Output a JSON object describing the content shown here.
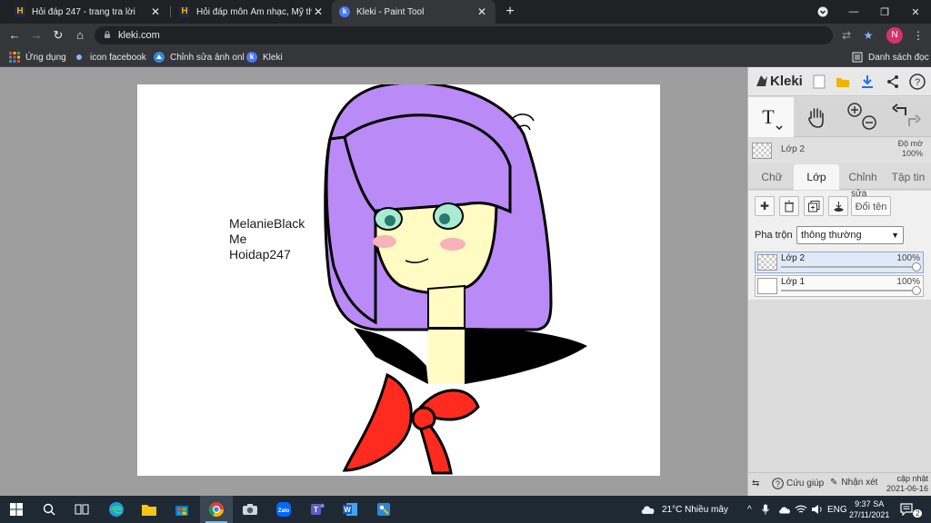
{
  "browser": {
    "tabs": [
      {
        "title": "Hỏi đáp 247 - trang tra lời",
        "favicon": "hoidap-favicon",
        "active": false
      },
      {
        "title": "Hỏi đáp môn Âm nhạc, Mỹ thuật",
        "favicon": "hoidap-favicon",
        "active": false
      },
      {
        "title": "Kleki - Paint Tool",
        "favicon": "kleki-favicon",
        "active": true
      }
    ],
    "url": "kleki.com",
    "profile_initial": "N",
    "bookmarks": [
      {
        "label": "Ứng dụng",
        "icon": "apps-grid-icon"
      },
      {
        "label": "icon facebook",
        "icon": "dot-icon"
      },
      {
        "label": "Chỉnh sửa ảnh onl",
        "icon": "photo-edit-icon"
      },
      {
        "label": "Kleki",
        "icon": "kleki-favicon"
      }
    ],
    "reading_list": "Danh sách đọc"
  },
  "canvas": {
    "signature_lines": [
      "MelanieBlack",
      "Me",
      "Hoidap247"
    ]
  },
  "kleki": {
    "logo": "Kleki",
    "current_layer_name": "Lớp 2",
    "opacity_label": "Độ mờ",
    "opacity_value": "100%",
    "tabs": [
      "Chữ",
      "Lớp",
      "Chỉnh",
      "Tập tin"
    ],
    "active_tab": "Lớp",
    "rename_label": "Đổi tên",
    "rename_overlay": "sửa",
    "blend_label": "Pha trộn",
    "blend_value": "thông thường",
    "layers": [
      {
        "name": "Lớp 2",
        "opacity": "100%",
        "opacity_fraction": 1.0,
        "selected": true
      },
      {
        "name": "Lớp 1",
        "opacity": "100%",
        "opacity_fraction": 1.0,
        "selected": false
      }
    ],
    "footer": {
      "help": "Cứu giúp",
      "feedback": "Nhận xét",
      "update_label": "cập nhật",
      "update_date": "2021-06-16"
    }
  },
  "taskbar": {
    "weather": "21°C  Nhiều mây",
    "language": "ENG",
    "time": "9:37 SA",
    "date": "27/11/2021",
    "notification_count": "2"
  }
}
